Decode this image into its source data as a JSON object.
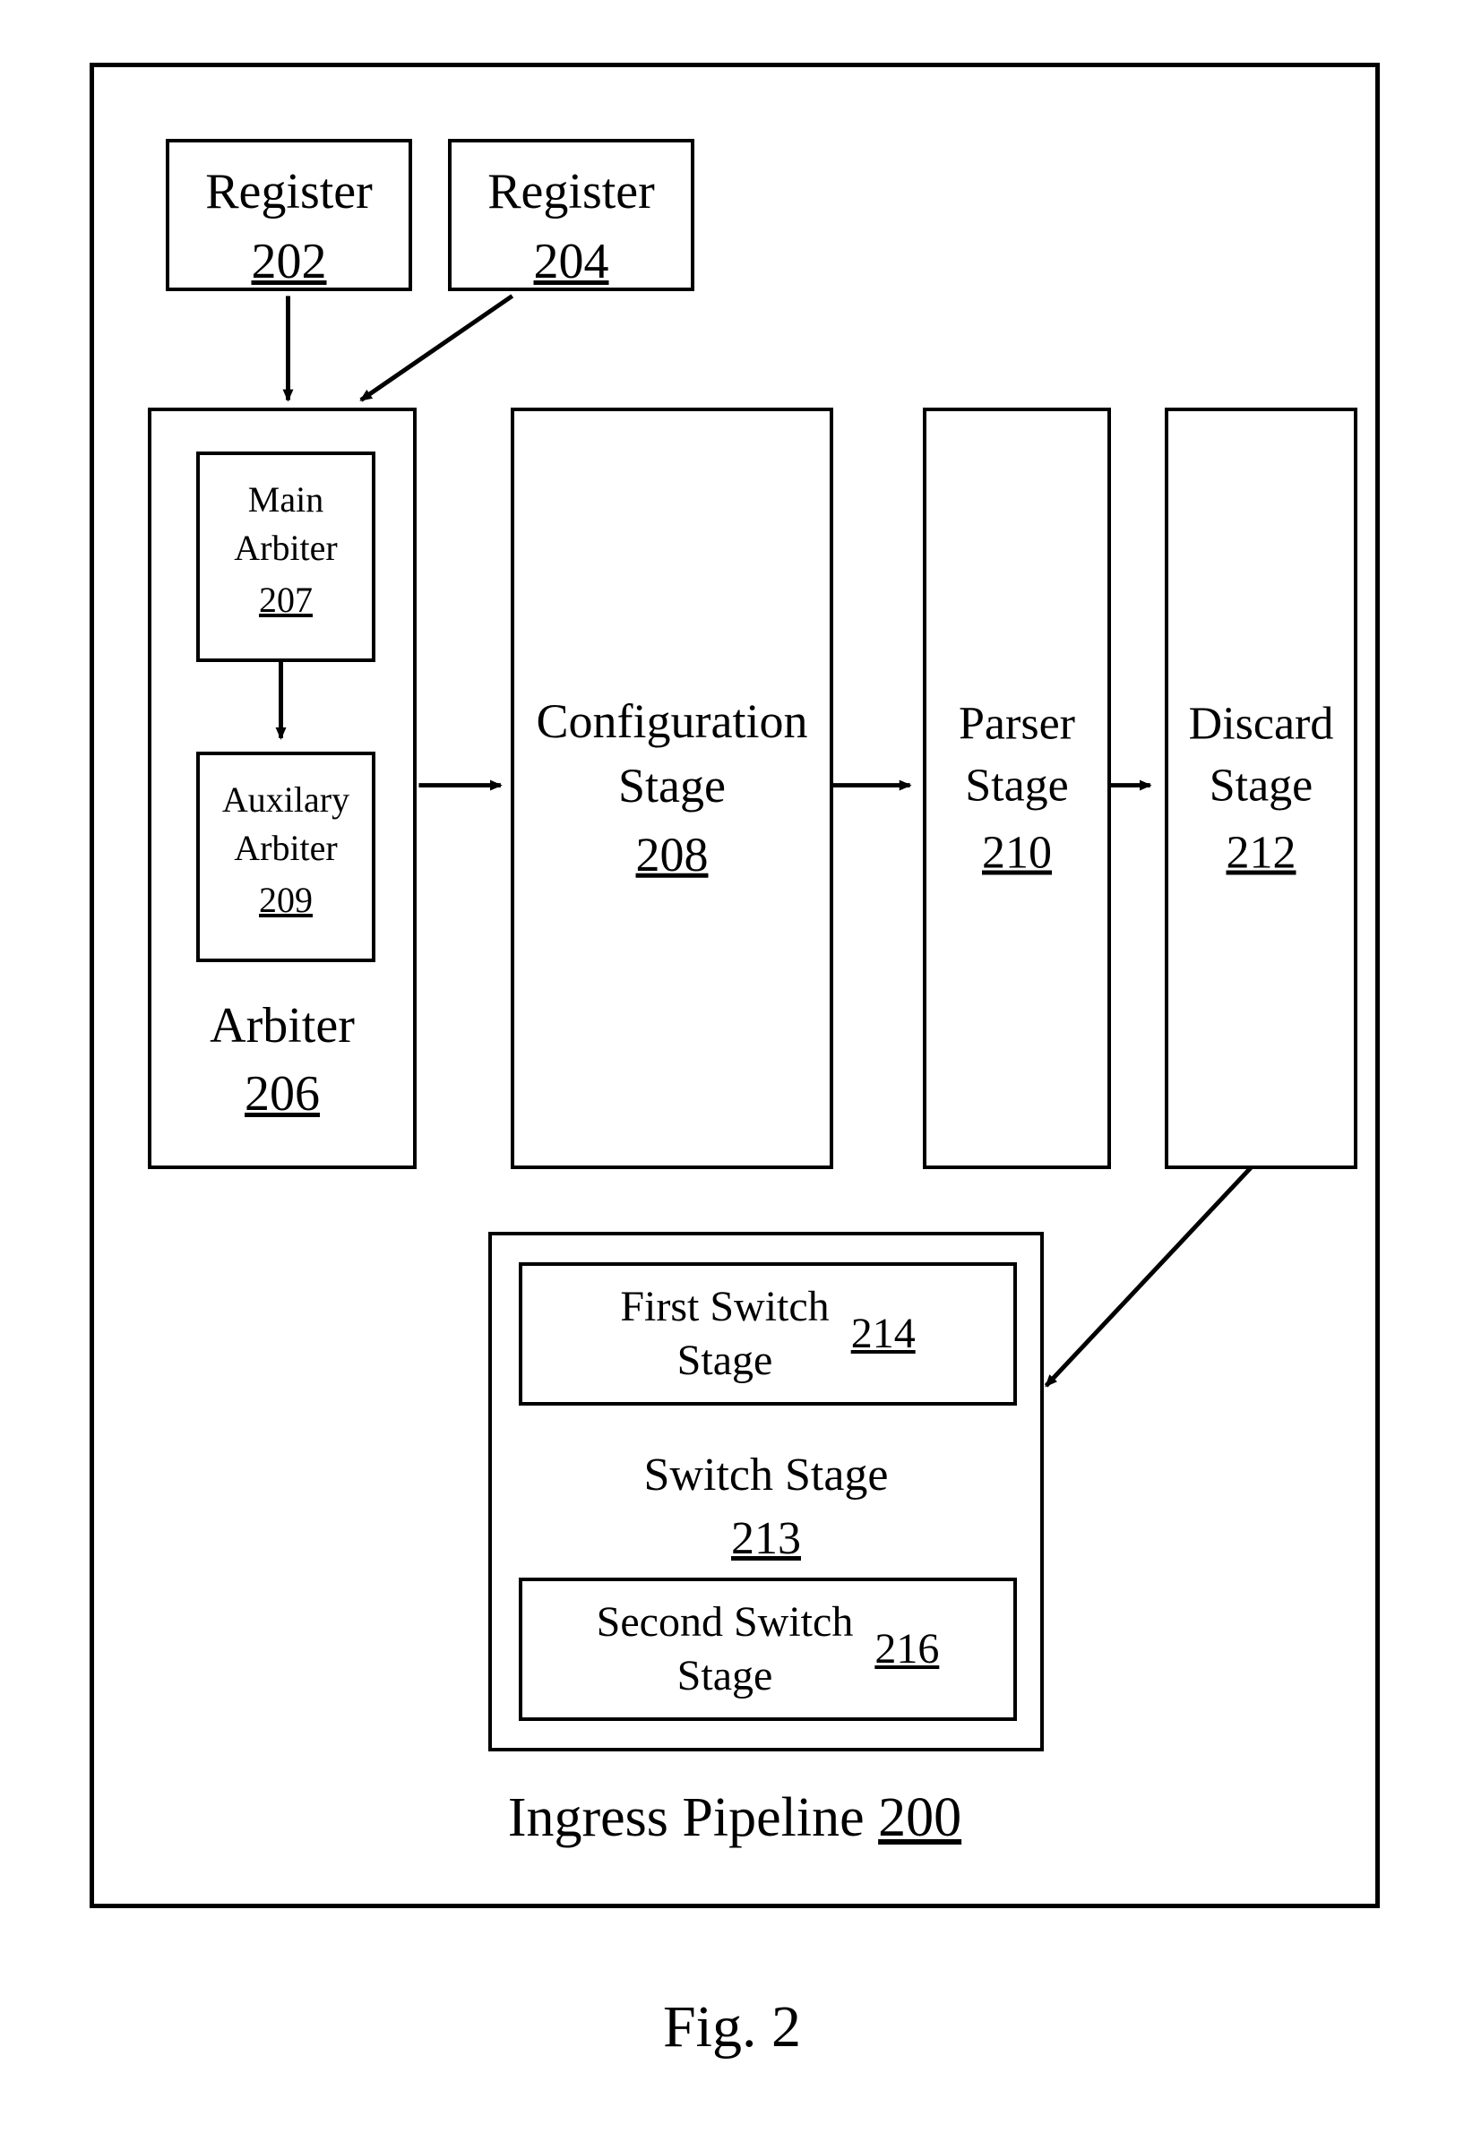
{
  "figure_caption": "Fig. 2",
  "pipeline": {
    "label": "Ingress Pipeline",
    "ref": "200"
  },
  "register_a": {
    "label": "Register",
    "ref": "202"
  },
  "register_b": {
    "label": "Register",
    "ref": "204"
  },
  "arbiter": {
    "label": "Arbiter",
    "ref": "206"
  },
  "main_arbiter": {
    "label_l1": "Main",
    "label_l2": "Arbiter",
    "ref": "207"
  },
  "aux_arbiter": {
    "label_l1": "Auxilary",
    "label_l2": "Arbiter",
    "ref": "209"
  },
  "config_stage": {
    "label_l1": "Configuration",
    "label_l2": "Stage",
    "ref": "208"
  },
  "parser_stage": {
    "label_l1": "Parser",
    "label_l2": "Stage",
    "ref": "210"
  },
  "discard_stage": {
    "label_l1": "Discard",
    "label_l2": "Stage",
    "ref": "212"
  },
  "switch_stage": {
    "label": "Switch Stage",
    "ref": "213"
  },
  "first_switch": {
    "label_l1": "First Switch",
    "label_l2": "Stage",
    "ref": "214"
  },
  "second_switch": {
    "label_l1": "Second Switch",
    "label_l2": "Stage",
    "ref": "216"
  }
}
